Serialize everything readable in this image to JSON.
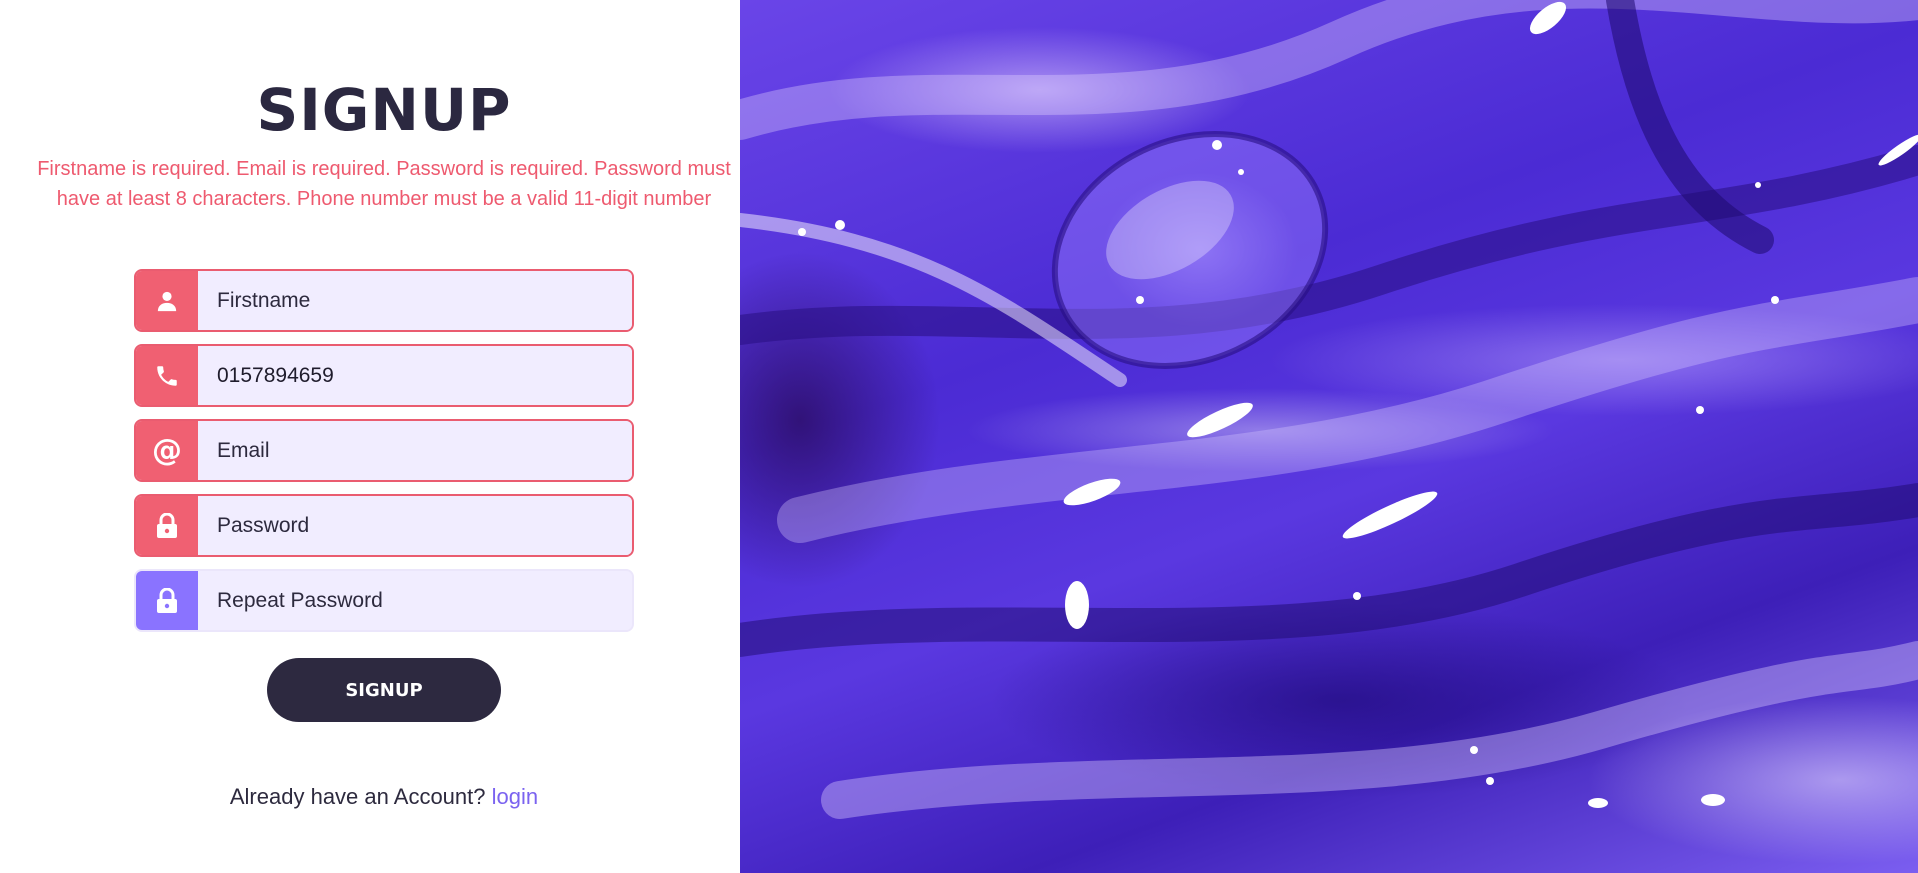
{
  "form": {
    "title": "SIGNUP",
    "error_message": "Firstname is required. Email is required. Password is required. Password must have at least 8 characters. Phone number must be a valid 11-digit number",
    "fields": [
      {
        "icon": "user-icon",
        "value": "",
        "placeholder": "Firstname"
      },
      {
        "icon": "phone-icon",
        "value": "0157894659",
        "placeholder": ""
      },
      {
        "icon": "at-sign-icon",
        "value": "",
        "placeholder": "Email"
      },
      {
        "icon": "lock-icon",
        "value": "",
        "placeholder": "Password"
      },
      {
        "icon": "lock-icon",
        "value": "",
        "placeholder": "Repeat Password"
      }
    ],
    "submit_label": "SIGNUP",
    "footer_text": "Already have an Account?",
    "login_link": "login"
  },
  "colors": {
    "error": "#ee5a6f",
    "accent": "#8a73ff",
    "button": "#2d2940",
    "link": "#7b63f0"
  }
}
